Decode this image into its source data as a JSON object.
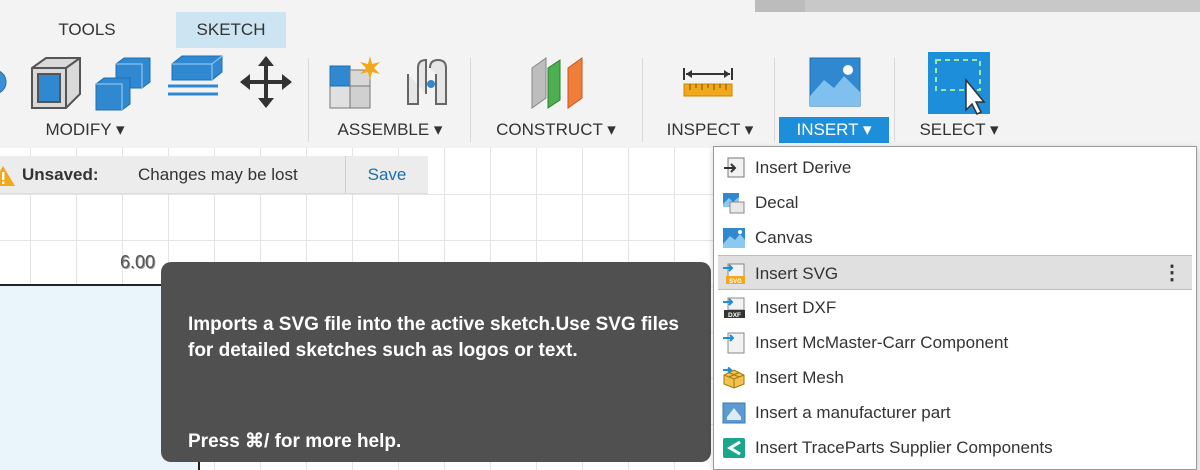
{
  "tabs": [
    {
      "label": "TOOLS"
    },
    {
      "label": "SKETCH"
    }
  ],
  "toolbar": {
    "modify_label": "MODIFY ▾",
    "assemble_label": "ASSEMBLE ▾",
    "construct_label": "CONSTRUCT ▾",
    "inspect_label": "INSPECT ▾",
    "insert_label": "INSERT ▾",
    "select_label": "SELECT ▾"
  },
  "unsaved": {
    "label": "Unsaved:",
    "message": "Changes may be lost",
    "save_label": "Save"
  },
  "canvas": {
    "dimension_text": "6.00"
  },
  "tooltip": {
    "description": "Imports a SVG file into the active sketch.Use SVG files for detailed sketches such as logos or text.",
    "hint": "Press ⌘/ for more help."
  },
  "insert_menu": {
    "items": [
      {
        "label": "Insert Derive",
        "icon": "insert-derive-icon"
      },
      {
        "label": "Decal",
        "icon": "decal-icon"
      },
      {
        "label": "Canvas",
        "icon": "canvas-icon"
      },
      {
        "label": "Insert SVG",
        "icon": "insert-svg-icon",
        "highlighted": true
      },
      {
        "label": "Insert DXF",
        "icon": "insert-dxf-icon"
      },
      {
        "label": "Insert McMaster-Carr Component",
        "icon": "mcmaster-carr-icon"
      },
      {
        "label": "Insert Mesh",
        "icon": "insert-mesh-icon"
      },
      {
        "label": "Insert a manufacturer part",
        "icon": "manufacturer-part-icon"
      },
      {
        "label": "Insert TraceParts Supplier Components",
        "icon": "traceparts-icon"
      }
    ],
    "more_glyph": "⋮"
  },
  "colors": {
    "accent": "#1d8ed9",
    "sketch_tab": "#cde4f2",
    "tooltip_bg": "#505050",
    "save_link": "#1a6fa8"
  }
}
